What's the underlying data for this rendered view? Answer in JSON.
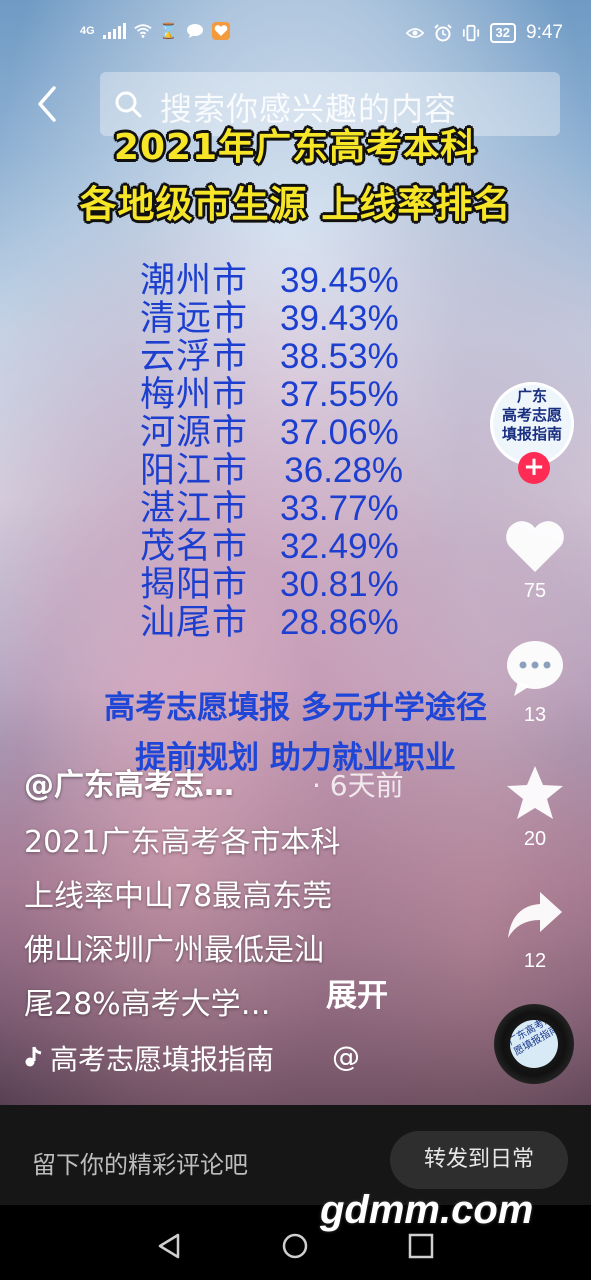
{
  "status_bar": {
    "network": "4G",
    "battery": "32",
    "time": "9:47"
  },
  "search": {
    "placeholder": "搜索你感兴趣的内容"
  },
  "video_overlay": {
    "title_line1": "2021年广东高考本科",
    "title_line2": "各地级市生源 上线率排名",
    "ranking": [
      {
        "city": "潮州市",
        "rate": "39.45%"
      },
      {
        "city": "清远市",
        "rate": "39.43%"
      },
      {
        "city": "云浮市",
        "rate": "38.53%"
      },
      {
        "city": "梅州市",
        "rate": "37.55%"
      },
      {
        "city": "河源市",
        "rate": "37.06%"
      },
      {
        "city": "阳江市",
        "rate": "36.28%"
      },
      {
        "city": "湛江市",
        "rate": "33.77%"
      },
      {
        "city": "茂名市",
        "rate": "32.49%"
      },
      {
        "city": "揭阳市",
        "rate": "30.81%"
      },
      {
        "city": "汕尾市",
        "rate": "28.86%"
      }
    ],
    "slogan_line1": "高考志愿填报 多元升学途径",
    "slogan_line2": "提前规划 助力就业职业"
  },
  "caption": {
    "author": "@广东高考志…",
    "time": "· 6天前",
    "desc_lines": [
      "2021广东高考各市本科",
      "上线率中山78最高东莞",
      "佛山深圳广州最低是汕",
      "尾28%高考大学…"
    ],
    "expand": "展开",
    "music": "高考志愿填报指南",
    "at": "@"
  },
  "right_rail": {
    "avatar_text": "广东\n高考志愿\n填报指南",
    "follow": "+",
    "like_count": "75",
    "comment_count": "13",
    "favorite_count": "20",
    "share_count": "12",
    "disc_text": "广东高考志愿填报指南"
  },
  "bottom": {
    "comment_placeholder": "留下你的精彩评论吧",
    "share_daily": "转发到日常"
  },
  "watermark": "gdmm.com",
  "colors": {
    "title_yellow": "#f7e628",
    "rank_blue": "#1d3fd0",
    "follow_red": "#fe2c55"
  }
}
